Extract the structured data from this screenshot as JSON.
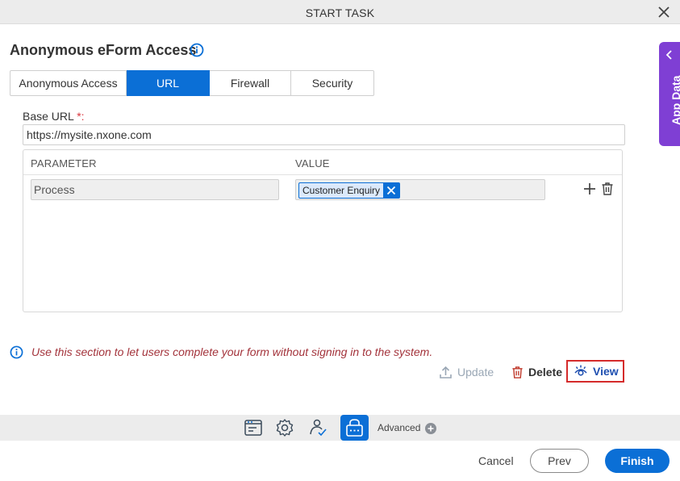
{
  "window": {
    "title": "START TASK"
  },
  "heading": {
    "title": "Anonymous eForm Access"
  },
  "tabs": [
    {
      "label": "Anonymous Access"
    },
    {
      "label": "URL",
      "active": true
    },
    {
      "label": "Firewall"
    },
    {
      "label": "Security"
    }
  ],
  "app_data": {
    "label": "App Data"
  },
  "base_url": {
    "label": "Base URL",
    "required_mark": "*:",
    "value": "https://mysite.nxone.com"
  },
  "grid": {
    "columns": [
      "PARAMETER",
      "VALUE"
    ],
    "rows": [
      {
        "parameter": "Process",
        "value_chip": "Customer Enquiry"
      }
    ]
  },
  "note": "Use this section to let users complete your form without signing in to the system.",
  "actions": {
    "update": "Update",
    "delete": "Delete",
    "view": "View"
  },
  "toolbar": {
    "advanced": "Advanced"
  },
  "footer": {
    "cancel": "Cancel",
    "prev": "Prev",
    "finish": "Finish"
  },
  "colors": {
    "primary": "#0b6fd6",
    "app_data": "#7f3fd4",
    "note": "#a3333b",
    "highlight": "#d52b2b"
  }
}
